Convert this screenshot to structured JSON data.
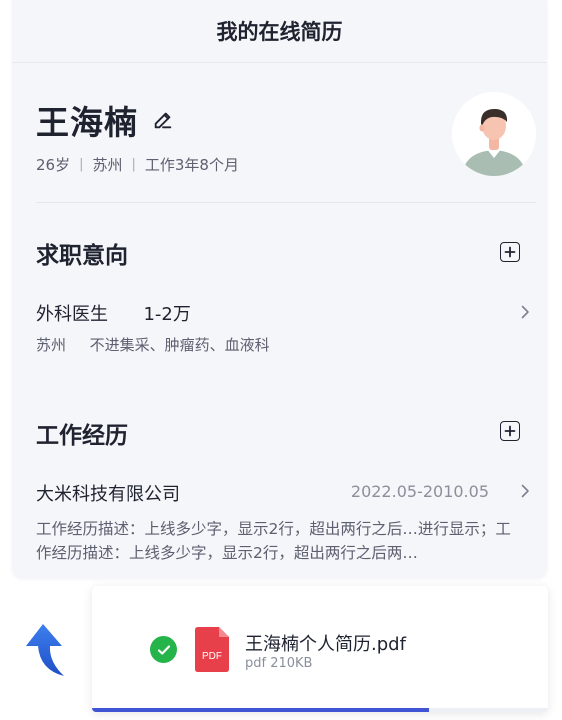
{
  "header": {
    "title": "我的在线简历"
  },
  "profile": {
    "name": "王海楠",
    "age": "26岁",
    "city": "苏州",
    "experience": "工作3年8个月",
    "separator": "|"
  },
  "job_intent": {
    "title": "求职意向",
    "position": "外科医生",
    "salary": "1-2万",
    "city": "苏州",
    "industries": "不进集采、肿瘤药、血液科"
  },
  "work_history": {
    "title": "工作经历",
    "company": "大米科技有限公司",
    "period": "2022.05-2010.05",
    "description": "工作经历描述：上线多少字，显示2行，超出两行之后…进行显示；工作经历描述：上线多少字，显示2行，超出两行之后两…"
  },
  "upload_toast": {
    "file_name": "王海楠个人简历.pdf",
    "file_meta": "pdf 210KB",
    "file_type_label": "PDF",
    "progress": 0.74
  },
  "icons": {
    "edit": "pencil-icon",
    "add": "plus-square-icon",
    "chevron": "chevron-right-icon",
    "success": "check-circle-icon",
    "file": "pdf-file-icon",
    "back": "curved-up-arrow-icon"
  },
  "colors": {
    "accent": "#3f55d6",
    "success": "#24b44a",
    "pdf_red": "#e8404a",
    "arrow_blue": "#2f6fe0"
  }
}
